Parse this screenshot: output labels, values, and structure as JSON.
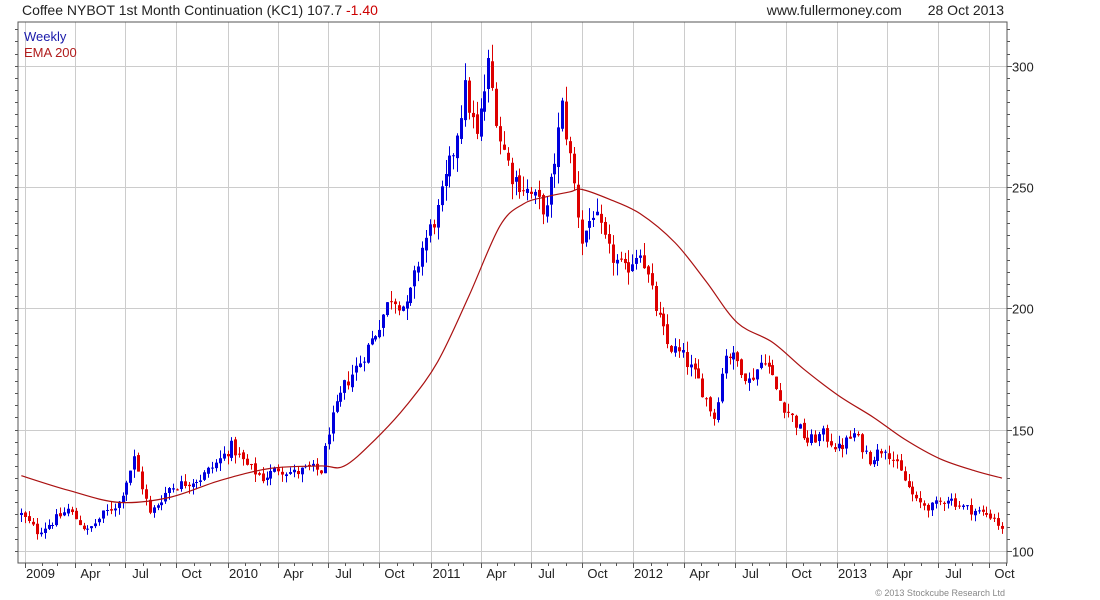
{
  "header": {
    "symbol_text": "Coffee NYBOT 1st Month Continuation (KC1) 107.7",
    "change": "-1.40",
    "website": "www.fullermoney.com",
    "date": "28 Oct 2013"
  },
  "legend": {
    "weekly": "Weekly",
    "ema": "EMA 200"
  },
  "copyright": "© 2013 Stockcube Research Ltd",
  "colors": {
    "up": "#0000dd",
    "down": "#dd0000",
    "ema": "#aa1111",
    "grid": "#cccccc"
  },
  "chart_data": {
    "type": "line",
    "title": "Coffee NYBOT 1st Month Continuation (KC1) 107.7 -1.40",
    "x_tick_labels": [
      "2009",
      "Apr",
      "Jul",
      "Oct",
      "2010",
      "Apr",
      "Jul",
      "Oct",
      "2011",
      "Apr",
      "Jul",
      "Oct",
      "2012",
      "Apr",
      "Jul",
      "Oct",
      "2013",
      "Apr",
      "Jul",
      "Oct"
    ],
    "y_ticks": [
      100,
      150,
      200,
      250,
      300
    ],
    "ylim": [
      95,
      318
    ],
    "grid": true,
    "y_axis_side": "right",
    "series": [
      {
        "name": "Weekly",
        "anchor_dates": [
          "2008-12-26",
          "2009-01-23",
          "2009-02-20",
          "2009-03-20",
          "2009-04-24",
          "2009-05-22",
          "2009-06-19",
          "2009-07-17",
          "2009-08-14",
          "2009-09-18",
          "2009-10-16",
          "2009-11-13",
          "2009-12-11",
          "2010-01-08",
          "2010-02-05",
          "2010-03-05",
          "2010-04-02",
          "2010-04-30",
          "2010-05-28",
          "2010-06-18",
          "2010-07-02",
          "2010-07-30",
          "2010-08-27",
          "2010-09-24",
          "2010-10-22",
          "2010-11-19",
          "2010-12-17",
          "2011-01-14",
          "2011-02-11",
          "2011-03-04",
          "2011-03-25",
          "2011-04-15",
          "2011-05-06",
          "2011-05-27",
          "2011-06-17",
          "2011-07-08",
          "2011-07-29",
          "2011-08-26",
          "2011-09-09",
          "2011-09-30",
          "2011-10-21",
          "2011-11-18",
          "2011-12-16",
          "2012-01-13",
          "2012-02-10",
          "2012-03-02",
          "2012-03-30",
          "2012-04-27",
          "2012-05-25",
          "2012-06-15",
          "2012-07-06",
          "2012-07-27",
          "2012-08-24",
          "2012-09-21",
          "2012-10-12",
          "2012-11-09",
          "2012-12-07",
          "2013-01-04",
          "2013-02-01",
          "2013-03-01",
          "2013-03-29",
          "2013-04-26",
          "2013-05-24",
          "2013-06-21",
          "2013-07-19",
          "2013-08-16",
          "2013-09-13",
          "2013-10-11",
          "2013-10-25"
        ],
        "anchor_close": [
          115,
          108,
          112,
          117,
          108,
          115,
          120,
          138,
          115,
          126,
          128,
          130,
          136,
          143,
          135,
          130,
          134,
          132,
          134,
          133,
          150,
          168,
          178,
          190,
          205,
          200,
          225,
          240,
          265,
          290,
          270,
          300,
          270,
          255,
          250,
          245,
          240,
          283,
          262,
          228,
          240,
          223,
          215,
          225,
          200,
          185,
          180,
          170,
          155,
          182,
          178,
          170,
          180,
          162,
          155,
          145,
          148,
          142,
          148,
          138,
          143,
          132,
          120,
          118,
          122,
          118,
          116,
          114,
          108
        ]
      },
      {
        "name": "EMA 200",
        "anchor_dates": [
          "2008-12-26",
          "2009-03-20",
          "2009-06-19",
          "2009-09-18",
          "2009-12-18",
          "2010-03-19",
          "2010-06-18",
          "2010-07-30",
          "2010-09-24",
          "2010-11-19",
          "2011-01-14",
          "2011-03-11",
          "2011-05-06",
          "2011-06-17",
          "2011-07-29",
          "2011-09-09",
          "2011-09-30",
          "2011-11-18",
          "2012-01-13",
          "2012-03-16",
          "2012-05-11",
          "2012-07-06",
          "2012-09-07",
          "2012-11-02",
          "2013-01-04",
          "2013-03-08",
          "2013-05-03",
          "2013-07-05",
          "2013-09-06",
          "2013-10-25"
        ],
        "values": [
          131,
          125,
          120,
          122,
          129,
          134,
          135,
          135,
          146,
          160,
          178,
          205,
          234,
          243,
          246,
          248,
          249,
          245,
          239,
          227,
          211,
          194,
          186,
          175,
          164,
          155,
          146,
          138,
          133,
          130
        ]
      }
    ]
  }
}
